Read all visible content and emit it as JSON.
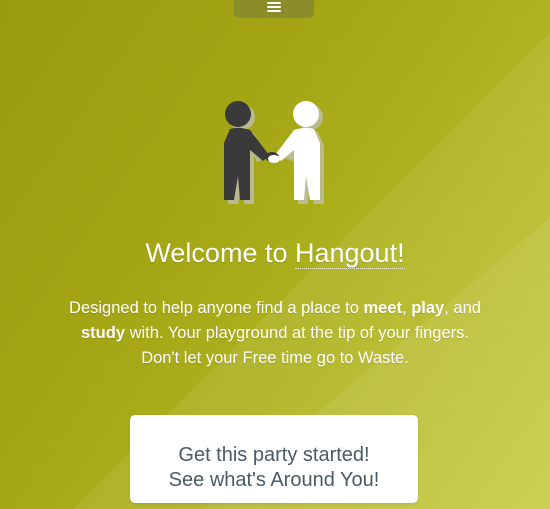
{
  "header": {
    "menu_icon": "hamburger-menu-icon"
  },
  "hero": {
    "illustration_icon": "handshake-figures-icon",
    "title_prefix": "Welcome to ",
    "title_brand": "Hangout!",
    "description": {
      "part1": "Designed to help anyone find a place to ",
      "meet": "meet",
      "sep1": ", ",
      "play": "play",
      "part2": ", and",
      "study": "study",
      "part3": " with. Your playground at the tip of your fingers.",
      "line3": "Don't let your Free time go to Waste."
    },
    "cta": {
      "line1": "Get this party started!",
      "line2": "See what's Around You!"
    }
  },
  "colors": {
    "background": "#a3a514",
    "background_light": "#c4c935",
    "text": "#ffffff",
    "button_bg": "#ffffff",
    "button_text": "#4a5a66",
    "figure_dark": "#3a3a3a",
    "figure_light": "#ffffff"
  }
}
